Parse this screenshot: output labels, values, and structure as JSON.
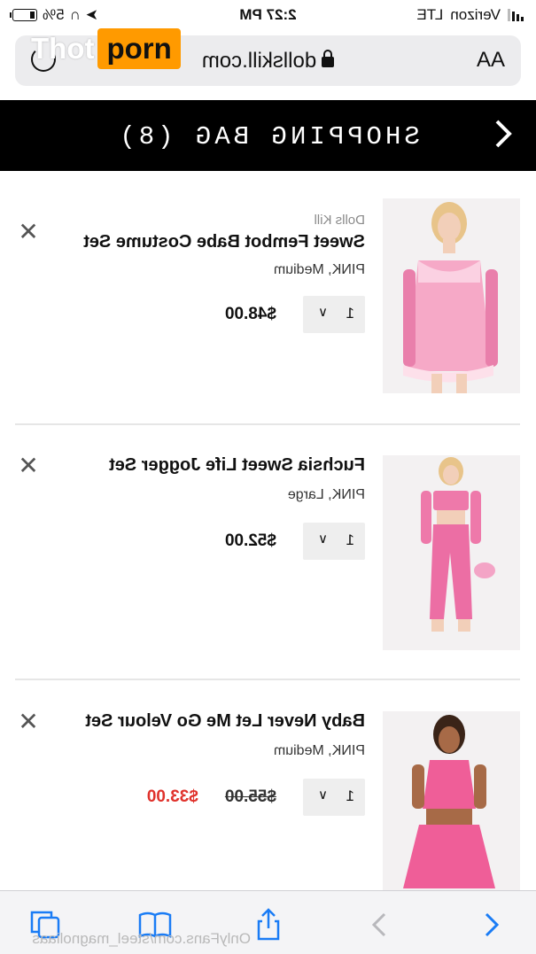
{
  "status_bar": {
    "carrier": "Verizon",
    "network": "LTE",
    "time": "2:27 PM",
    "battery_percent": "5%"
  },
  "url_bar": {
    "text_size_label": "AA",
    "domain": "dollskill.com",
    "icons": [
      "lock-icon",
      "reload-icon"
    ]
  },
  "header": {
    "title": "SHOPPING BAG (8)",
    "back_icon": "chevron-left-icon"
  },
  "items": [
    {
      "brand": "Dolls Kill",
      "name": "Sweet Fembot Babe Costume Set",
      "variant": "PINK, Medium",
      "quantity": "1",
      "price": "$48.00",
      "image_desc": "pink-fluffy-babydoll-photo"
    },
    {
      "brand": "",
      "name": "Fuchsia Sweet Life Jogger Set",
      "variant": "PINK, Large",
      "quantity": "1",
      "price": "$52.00",
      "image_desc": "pink-velour-jogger-photo"
    },
    {
      "brand": "",
      "name": "Baby Never Let Me Go Velour Set",
      "variant": "PINK, Medium",
      "quantity": "1",
      "original_price": "$55.00",
      "sale_price": "$33.00",
      "image_desc": "pink-velour-skirt-set-photo"
    }
  ],
  "toolbar": {
    "icons": [
      "chevron-left-icon",
      "chevron-right-icon",
      "share-icon",
      "bookmarks-icon",
      "tabs-icon"
    ]
  },
  "watermarks": {
    "onlyfans": "OnlyFans.com/steel_magnoliaas",
    "logo_white": "Thot",
    "logo_orange": "porn"
  },
  "colors": {
    "header_bg": "#000000",
    "sale_price": "#e0322c",
    "link_blue": "#1a7cf5",
    "logo_orange": "#ff9a00"
  }
}
